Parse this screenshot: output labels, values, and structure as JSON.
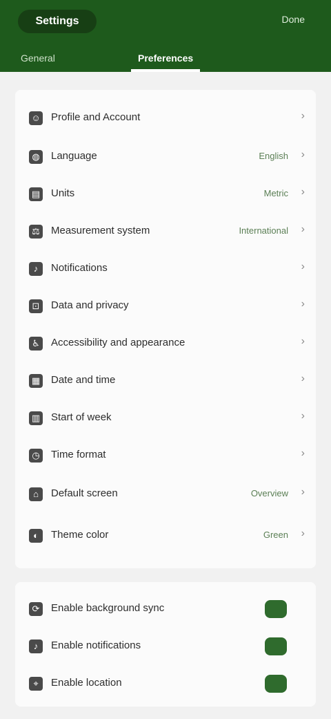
{
  "header": {
    "title": "Settings",
    "action_label": "Done"
  },
  "tabs": [
    {
      "label": "General"
    },
    {
      "label": "Preferences"
    }
  ],
  "settings_list": {
    "items": [
      {
        "label": "Profile and Account",
        "value": ""
      },
      {
        "label": "Language",
        "value": "English"
      },
      {
        "label": "Units",
        "value": "Metric"
      },
      {
        "label": "Measurement system",
        "value": "International"
      },
      {
        "label": "Notifications",
        "value": ""
      },
      {
        "label": "Data and privacy",
        "value": ""
      },
      {
        "label": "Accessibility and appearance",
        "value": ""
      },
      {
        "label": "Date and time",
        "value": ""
      },
      {
        "label": "Start of week",
        "value": ""
      },
      {
        "label": "Time format",
        "value": ""
      },
      {
        "label": "Default screen",
        "value": "Overview"
      },
      {
        "label": "Theme color",
        "value": "Green"
      }
    ]
  },
  "toggles": {
    "items": [
      {
        "label": "Enable background sync",
        "enabled": true
      },
      {
        "label": "Enable notifications",
        "enabled": true
      },
      {
        "label": "Enable location",
        "enabled": true
      }
    ]
  }
}
